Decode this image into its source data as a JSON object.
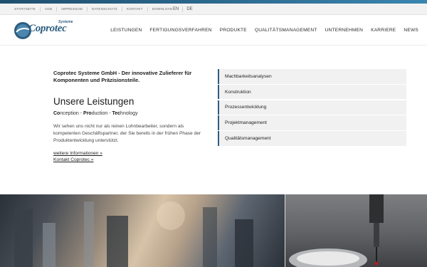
{
  "utility_bar": {
    "links": [
      "STARTSEITE",
      "AGB",
      "IMPRESSUM",
      "DATENSCHUTZ",
      "KONTAKT",
      "DOWNLOAD"
    ],
    "languages": [
      "EN",
      "DE"
    ]
  },
  "brand": {
    "name": "Coprotec",
    "suffix": "Systeme",
    "color": "#2d5d80"
  },
  "nav": [
    "LEISTUNGEN",
    "FERTIGUNGSVERFAHREN",
    "PRODUKTE",
    "QUALITÄTSMANAGEMENT",
    "UNTERNEHMEN",
    "KARRIERE",
    "NEWS"
  ],
  "intro": {
    "lead": "Coprotec Systeme GmbH - Der innovative Zulieferer für Komponenten und Präzisionsteile.",
    "title": "Unsere Leistungen",
    "tagline": {
      "w1_b": "Co",
      "w1": "nception - ",
      "w2_b": "Pro",
      "w2": "duction - ",
      "w3_b": "Tec",
      "w3": "hnology"
    },
    "description": "Wir sehen uns nicht nur als reinen Lohnbearbeiter, sondern als kompetenten Geschäftspartner, der Sie bereits in der frühen Phase der Produktentwicklung unterstützt.",
    "links": [
      "weitere Informationen »",
      "Kontakt Coprotec »"
    ]
  },
  "services": [
    "Machbarkeitsanalysen",
    "Konstruktion",
    "Prozessentwicklung",
    "Projektmanagement",
    "Qualitätsmanagement"
  ],
  "colors": {
    "accent": "#2c5f84",
    "service_bg": "#f1f1f1"
  }
}
